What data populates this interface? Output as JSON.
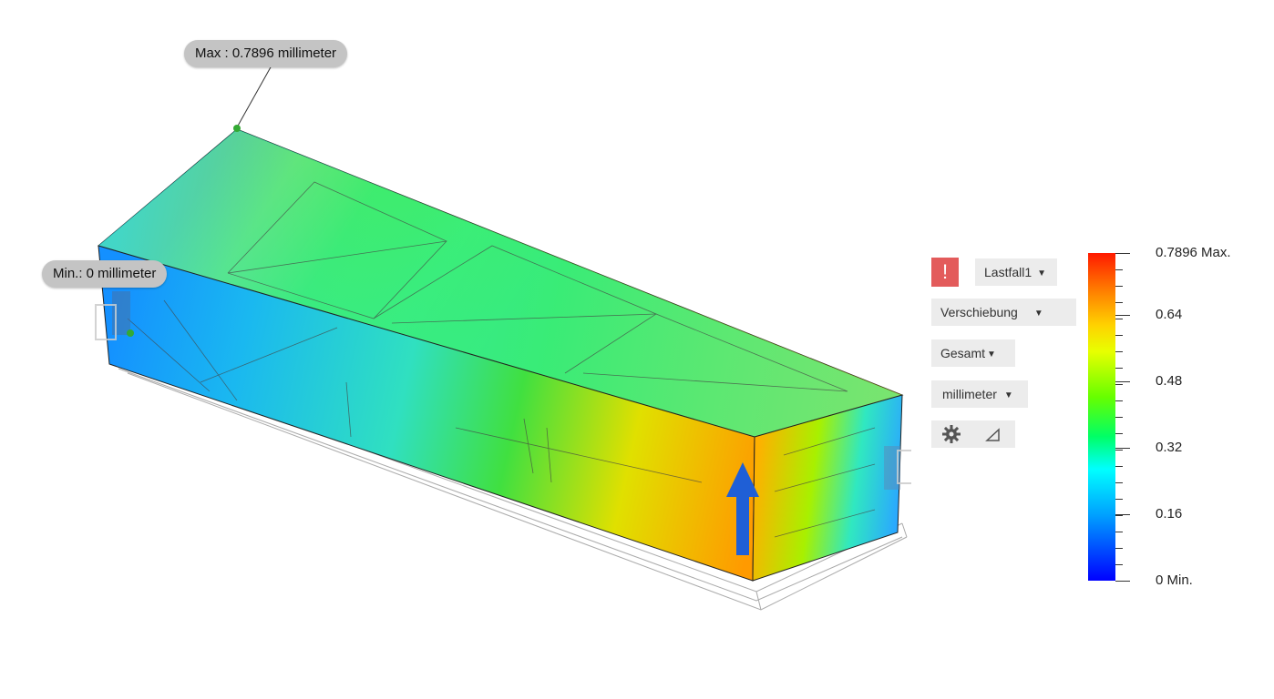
{
  "probes": {
    "max_label": "Max : 0.7896 millimeter",
    "min_label": "Min.: 0 millimeter"
  },
  "controls": {
    "warning_symbol": "!",
    "load_case": "Lastfall1",
    "result_type": "Verschiebung",
    "component": "Gesamt",
    "unit": "millimeter",
    "settings_icon": "gear-icon",
    "probe_icon": "triangle-icon"
  },
  "legend": {
    "min": 0,
    "max": 0.7896,
    "ticks": [
      {
        "value": "0.7896 Max.",
        "fraction": 1.0
      },
      {
        "value": "0.64",
        "fraction": 0.8105
      },
      {
        "value": "0.48",
        "fraction": 0.6079
      },
      {
        "value": "0.32",
        "fraction": 0.4053
      },
      {
        "value": "0.16",
        "fraction": 0.2026
      },
      {
        "value": "0 Min.",
        "fraction": 0.0
      }
    ]
  },
  "colors": {
    "warning": "#e35b5b",
    "load_arrow": "#1f5fd6",
    "callout_bg": "#c4c4c4"
  }
}
